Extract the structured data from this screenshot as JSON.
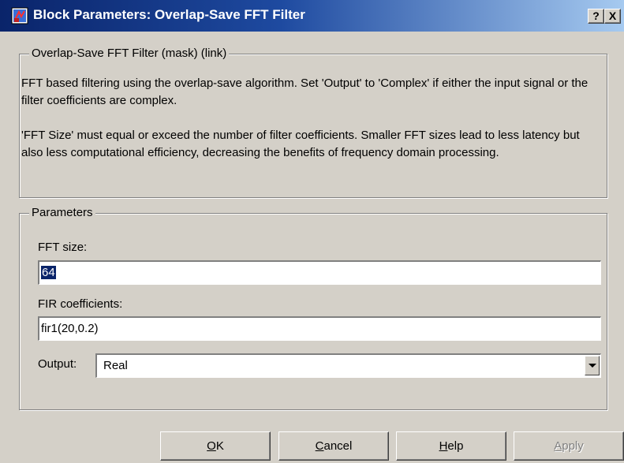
{
  "window": {
    "title": "Block Parameters: Overlap-Save FFT Filter",
    "help_glyph": "?",
    "close_glyph": "X"
  },
  "description": {
    "legend": "Overlap-Save FFT Filter (mask) (link)",
    "paragraph1": "FFT based filtering using the overlap-save algorithm.  Set 'Output' to 'Complex' if either the input signal or the filter coefficients are complex.",
    "paragraph2": "'FFT Size' must equal or exceed the number of filter coefficients.  Smaller FFT sizes lead to less latency but also less computational efficiency, decreasing the benefits of frequency domain processing."
  },
  "parameters": {
    "legend": "Parameters",
    "fft_size": {
      "label": "FFT size:",
      "value": "64"
    },
    "fir_coefficients": {
      "label": "FIR coefficients:",
      "value": "fir1(20,0.2)"
    },
    "output": {
      "label": "Output:",
      "selected": "Real"
    }
  },
  "buttons": {
    "ok": {
      "mnemonic": "O",
      "rest": "K"
    },
    "cancel": {
      "mnemonic": "C",
      "rest": "ancel"
    },
    "help": {
      "mnemonic": "H",
      "rest": "elp"
    },
    "apply": {
      "mnemonic": "A",
      "rest": "pply",
      "enabled": false
    }
  },
  "colors": {
    "titlebar_start": "#0a246a",
    "titlebar_end": "#a6caf0",
    "face": "#d4d0c8",
    "selection": "#0a246a"
  },
  "icons": {
    "app": "simulink-block-icon",
    "help": "question-mark-icon",
    "close": "close-x-icon",
    "dropdown": "chevron-down-icon"
  }
}
